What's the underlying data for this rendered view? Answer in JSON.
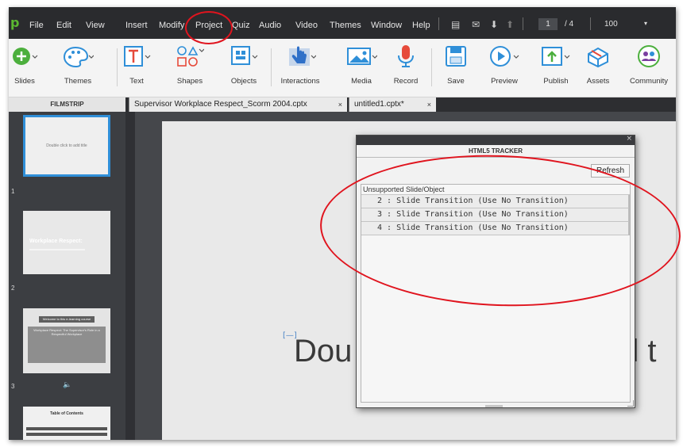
{
  "app": {
    "logo_text": "p",
    "menu": [
      "File",
      "Edit",
      "View",
      "Insert",
      "Modify",
      "Project",
      "Quiz",
      "Audio",
      "Video",
      "Themes",
      "Window",
      "Help"
    ],
    "current_slide": "1",
    "slide_total": "/ 4",
    "zoom": "100"
  },
  "toolbar": {
    "slides": "Slides",
    "themes": "Themes",
    "text": "Text",
    "shapes": "Shapes",
    "objects": "Objects",
    "interactions": "Interactions",
    "media": "Media",
    "record": "Record",
    "save": "Save",
    "preview": "Preview",
    "publish": "Publish",
    "assets": "Assets",
    "community": "Community"
  },
  "tabs": {
    "filmstrip": "FILMSTRIP",
    "doc1": "Supervisor Workplace Respect_Scorm 2004.cptx",
    "doc2": "untitled1.cptx*",
    "close": "×"
  },
  "filmstrip": {
    "slide1_text": "Double click to add title",
    "slide2_title": "Workplace Respect:",
    "slide3_banner": "Welcome to this e-learning course",
    "slide3_heading": "Workplace Respect: The Supervisor's Role in a Respectful Workplace",
    "slide4_title": "Table of Contents",
    "numbers": [
      "1",
      "2",
      "3"
    ]
  },
  "stage": {
    "slide_title": "Dou",
    "slide_title_tail": "d t"
  },
  "tracker": {
    "title": "HTML5 TRACKER",
    "close": "×",
    "refresh": "Refresh",
    "column_header": "Unsupported Slide/Object",
    "rows": [
      "2 : Slide Transition (Use No Transition)",
      "3 : Slide Transition (Use No Transition)",
      "4 : Slide Transition (Use No Transition)"
    ]
  },
  "colors": {
    "menubar": "#2a2b2e",
    "toolbar": "#f4f4f4",
    "annotation_red": "#e0141e",
    "accent_green": "#5bb731",
    "accent_blue": "#2f8fd8"
  }
}
